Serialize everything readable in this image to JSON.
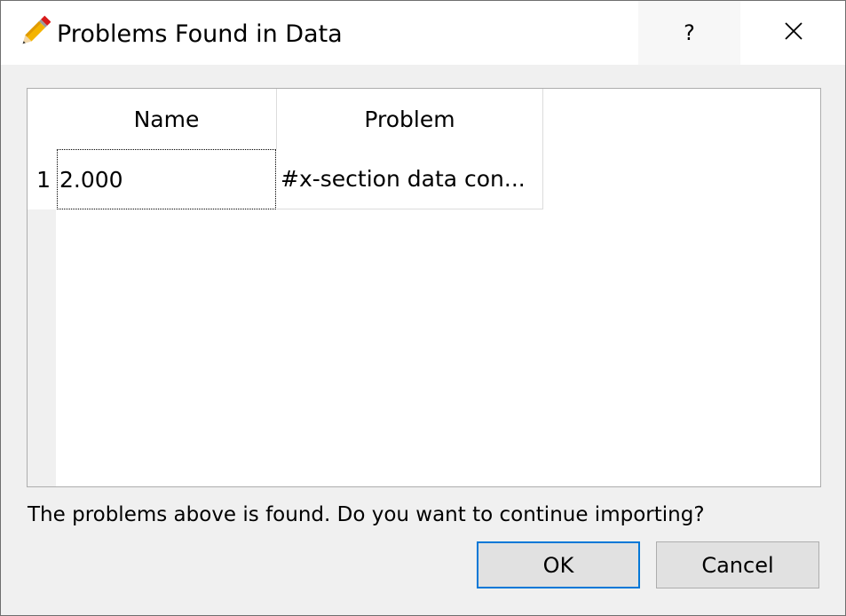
{
  "window": {
    "title": "Problems Found in Data",
    "help_label": "?",
    "icon": "pencil-icon",
    "close_icon": "close-icon"
  },
  "table": {
    "columns": [
      "Name",
      "Problem"
    ],
    "rows": [
      {
        "index": "1",
        "name": "2.000",
        "problem": "#x-section data con..."
      }
    ]
  },
  "message": "The problems above is found. Do you want to continue importing?",
  "buttons": {
    "ok_label": "OK",
    "cancel_label": "Cancel"
  },
  "colors": {
    "accent": "#0078d7",
    "dialog_bg": "#f0f0f0",
    "button_bg": "#e1e1e1"
  }
}
